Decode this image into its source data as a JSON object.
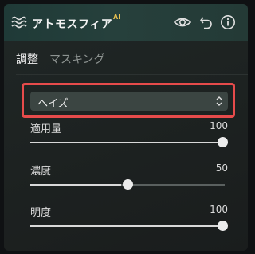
{
  "header": {
    "title": "アトモスフィア",
    "title_badge": "AI",
    "icons": [
      "waves-icon",
      "eye-icon",
      "undo-icon",
      "info-icon"
    ]
  },
  "tabs": [
    {
      "label": "調整",
      "active": true
    },
    {
      "label": "マスキング",
      "active": false
    }
  ],
  "preset": {
    "value": "ヘイズ",
    "highlight_color": "#e64b4b"
  },
  "sliders": [
    {
      "label": "適用量",
      "value": "100",
      "level_percent": 100
    },
    {
      "label": "濃度",
      "value": "50",
      "level_percent": 50
    },
    {
      "label": "明度",
      "value": "100",
      "level_percent": 100
    }
  ],
  "colors": {
    "header_accent": "#26403c",
    "panel_bg": "#1d2221",
    "ai_badge": "#e8c050"
  }
}
